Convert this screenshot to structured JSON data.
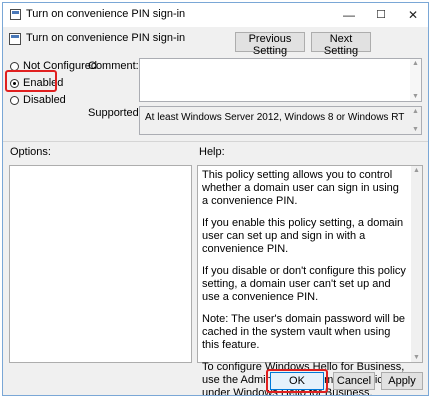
{
  "window": {
    "title": "Turn on convenience PIN sign-in",
    "controls": {
      "minimize": "—",
      "maximize": "☐",
      "close": "✕"
    }
  },
  "header": {
    "title": "Turn on convenience PIN sign-in",
    "previous_setting": "Previous Setting",
    "next_setting": "Next Setting"
  },
  "state_options": [
    {
      "label": "Not Configured",
      "selected": false
    },
    {
      "label": "Enabled",
      "selected": true
    },
    {
      "label": "Disabled",
      "selected": false
    }
  ],
  "comment": {
    "label": "Comment:",
    "value": ""
  },
  "supported_on": {
    "label": "Supported on:",
    "value": "At least Windows Server 2012, Windows 8 or Windows RT"
  },
  "options": {
    "label": "Options:"
  },
  "help": {
    "label": "Help:",
    "paragraphs": [
      "This policy setting allows you to control whether a domain user can sign in using a convenience PIN.",
      "If you enable this policy setting, a domain user can set up and sign in with a convenience PIN.",
      "If you disable or don't configure this policy setting, a domain user can't set up and use a convenience PIN.",
      "Note: The user's domain password will be cached in the system vault when using this feature.",
      "To configure Windows Hello for Business, use the Administrative Template policies under Windows Hello for Business."
    ]
  },
  "footer": {
    "ok": "OK",
    "cancel": "Cancel",
    "apply": "Apply"
  },
  "colors": {
    "highlight": "#e02020",
    "focus": "#0078d7"
  }
}
